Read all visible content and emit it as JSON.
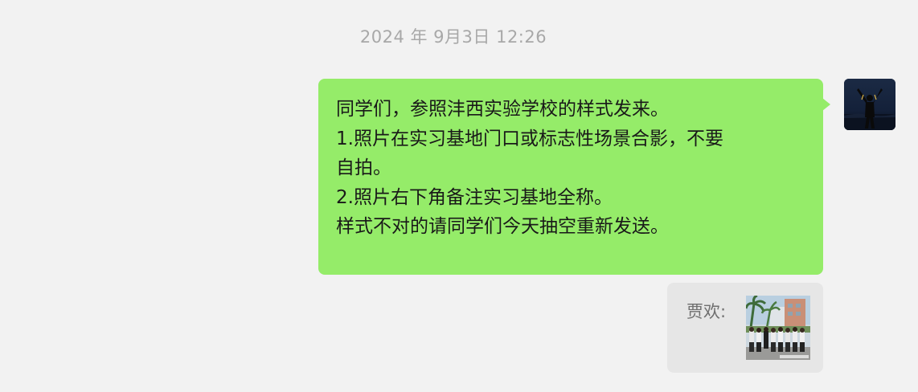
{
  "chat": {
    "timestamp": "2024 年 9月3日 12:26",
    "message": {
      "lines": [
        "同学们，参照沣西实验学校的样式发来。",
        "1.照片在实习基地门口或标志性场景合影，不要",
        "自拍。",
        "2.照片右下角备注实习基地全称。",
        "样式不对的请同学们今天抽空重新发送。"
      ],
      "bubble_color": "#95ec69"
    },
    "avatar": {
      "icon": "user-avatar-silhouette-icon"
    },
    "quote": {
      "sender": "贾欢:",
      "thumbnail_icon": "group-photo-thumbnail"
    }
  }
}
